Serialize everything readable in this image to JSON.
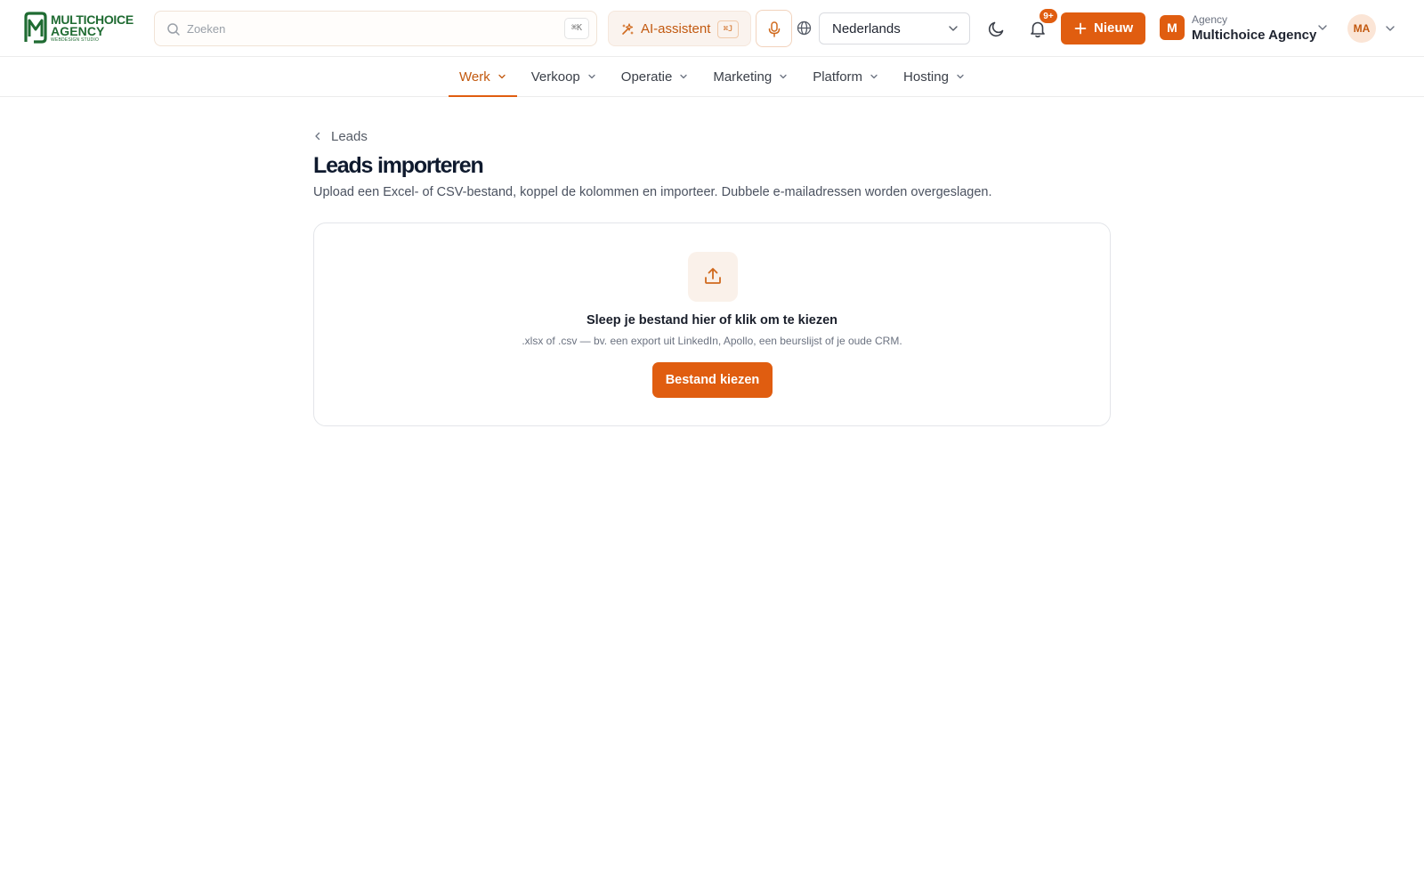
{
  "header": {
    "logo": {
      "line1": "MULTICHOICE",
      "line2": "AGENCY",
      "line3": "WEBDESIGN STUDIO"
    },
    "search": {
      "placeholder": "Zoeken",
      "value": "",
      "shortcut": "⌘K"
    },
    "ai_assistant": {
      "label": "AI-assistent",
      "shortcut": "⌘J"
    },
    "language": {
      "selected": "Nederlands"
    },
    "notifications": {
      "badge": "9+"
    },
    "new_button": {
      "label": "Nieuw"
    },
    "agency": {
      "avatar_letter": "M",
      "kicker": "Agency",
      "name": "Multichoice Agency"
    },
    "user": {
      "initials": "MA"
    },
    "icons": {
      "search": "search-icon",
      "ai": "sparkle-icon",
      "mic": "microphone-icon",
      "globe": "globe-icon",
      "theme": "moon-icon",
      "bell": "bell-icon",
      "plus": "plus-icon",
      "chevron": "chevron-down-icon"
    },
    "colors": {
      "accent": "#e05d10",
      "accent_text": "#c2590f",
      "brand_green": "#1f6b32"
    }
  },
  "nav": {
    "items": [
      {
        "label": "Werk",
        "active": true
      },
      {
        "label": "Verkoop",
        "active": false
      },
      {
        "label": "Operatie",
        "active": false
      },
      {
        "label": "Marketing",
        "active": false
      },
      {
        "label": "Platform",
        "active": false
      },
      {
        "label": "Hosting",
        "active": false
      }
    ]
  },
  "main": {
    "breadcrumb": {
      "label": "Leads"
    },
    "title": "Leads importeren",
    "description": "Upload een Excel- of CSV-bestand, koppel de kolommen en importeer. Dubbele e-mailadressen worden overgeslagen.",
    "dropzone": {
      "title": "Sleep je bestand hier of klik om te kiezen",
      "hint": ".xlsx of .csv — bv. een export uit LinkedIn, Apollo, een beurslijst of je oude CRM.",
      "button_label": "Bestand kiezen",
      "icon": "upload-icon"
    }
  }
}
